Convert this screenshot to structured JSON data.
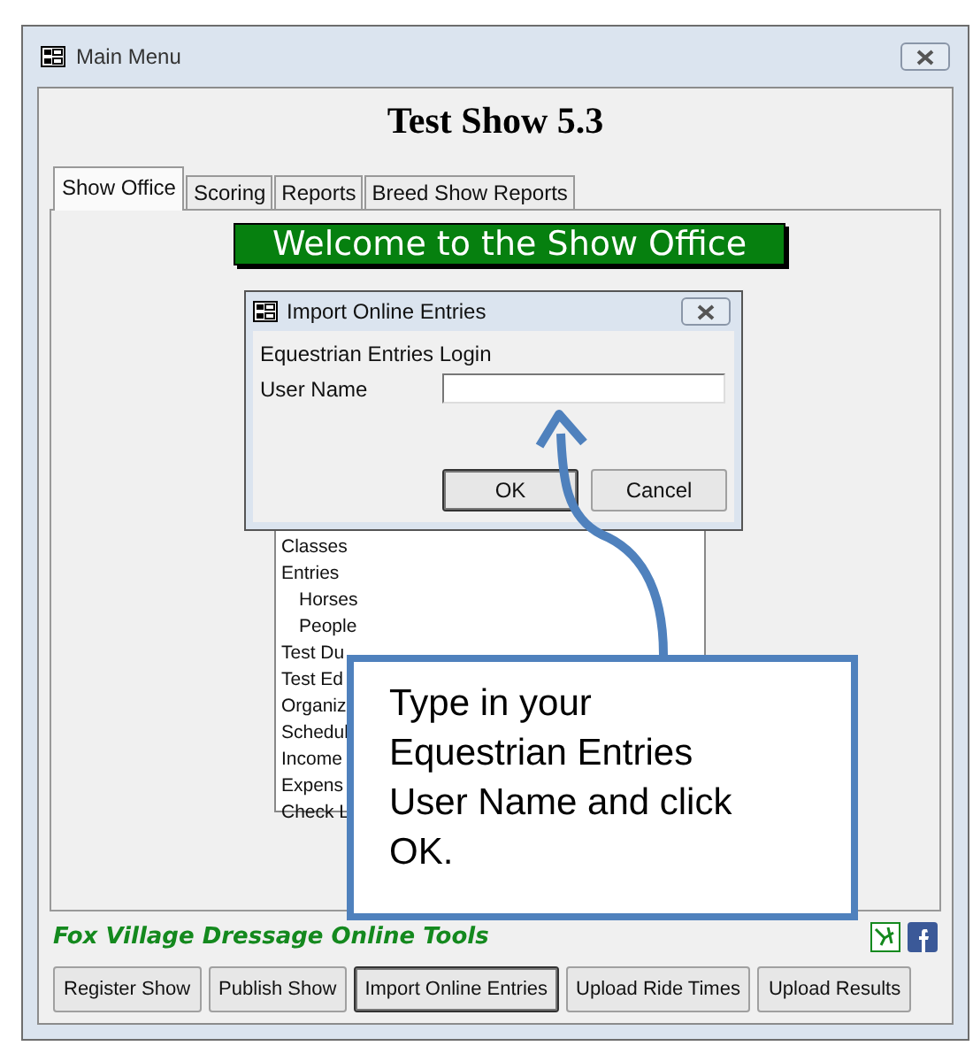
{
  "window": {
    "title": "Main Menu"
  },
  "heading": "Test Show 5.3",
  "tabs": [
    {
      "label": "Show Office",
      "selected": true
    },
    {
      "label": "Scoring",
      "selected": false
    },
    {
      "label": "Reports",
      "selected": false
    },
    {
      "label": "Breed Show Reports",
      "selected": false
    }
  ],
  "banner": "Welcome to the Show Office",
  "dialog": {
    "title": "Import Online Entries",
    "section_label": "Equestrian Entries Login",
    "field_label": "User Name",
    "buttons": [
      {
        "label": "OK",
        "focused": true
      },
      {
        "label": "Cancel",
        "focused": false
      }
    ]
  },
  "menu_list": [
    {
      "label": "Classes"
    },
    {
      "label": "Entries",
      "children": [
        {
          "label": "Horses"
        },
        {
          "label": "People"
        }
      ]
    },
    {
      "label": "Test Du"
    },
    {
      "label": "Test Ed"
    },
    {
      "label": "Organiz"
    },
    {
      "label": "Schedul"
    },
    {
      "label": "Income"
    },
    {
      "label": "Expens"
    },
    {
      "label": "Check L"
    }
  ],
  "callout": "Type in your Equestrian Entries User Name and click OK.",
  "footer": {
    "title": "Fox Village Dressage Online Tools",
    "buttons": [
      {
        "label": "Register Show",
        "focused": false
      },
      {
        "label": "Publish Show",
        "focused": false
      },
      {
        "label": "Import Online Entries",
        "focused": true
      },
      {
        "label": "Upload Ride Times",
        "focused": false
      },
      {
        "label": "Upload Results",
        "focused": false
      }
    ]
  }
}
